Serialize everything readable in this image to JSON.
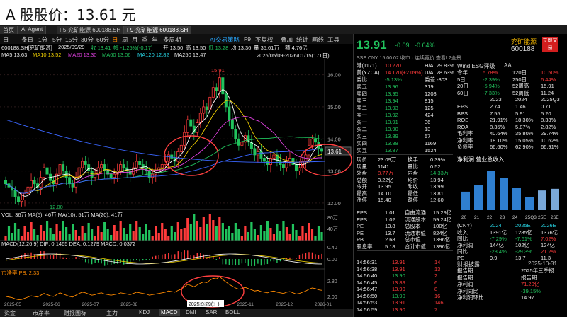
{
  "header": {
    "title": "A 股股价：13.61 元"
  },
  "tabs": [
    {
      "label": "首页",
      "active": false
    },
    {
      "label": "AI Agent",
      "active": false
    },
    {
      "label": "F5-兖矿能源 600188.SH",
      "active": false
    },
    {
      "label": "F9-兖矿能源 600188.SH",
      "active": true
    }
  ],
  "toolbar": {
    "periods": [
      "日",
      "多日",
      "1分",
      "5分",
      "15分",
      "30分",
      "60分",
      "日",
      "周",
      "月",
      "季",
      "年",
      "多周期"
    ],
    "right": [
      "AI交易策略",
      "F9",
      "不复权",
      "叠加",
      "统计",
      "画线",
      "工具"
    ]
  },
  "info_row": {
    "name": "600188.SH[兖矿能源]",
    "date": "2025/09/29",
    "close": "收 13.41",
    "change": "幅 -1.25%(-0.17)",
    "open": "开 13.50",
    "high": "高 13.50",
    "low": "低 13.28",
    "close2": "均 13.36",
    "volume": "量 35.61万",
    "turnover": "额 4.76亿"
  },
  "ma_row": {
    "ma5": "MA5 13.63",
    "ma10": "MA10 13.52",
    "ma20": "MA20 13.30",
    "ma60": "MA60 13.06",
    "ma120": "MA120 12.82",
    "ma250": "MA250 13.47",
    "range": "2025/05/09-2026/01/15(171日)"
  },
  "chart_data": {
    "type": "candlestick",
    "ylim": [
      12.0,
      16.2
    ],
    "yticks": [
      "16.00",
      "15.00",
      "14.00",
      "13.00",
      "12.00"
    ],
    "xticks": [
      "2025-05",
      "2025-06",
      "2025-07",
      "2025-08",
      "2025-09",
      "2025-10",
      "2025-11",
      "2025-12",
      "2026-01"
    ],
    "annotations": {
      "high": "15.91",
      "low": "12.00",
      "current": "13.61",
      "crosshair_date": "2025-9-29(一)"
    },
    "close": [
      12.6,
      12.5,
      12.4,
      12.2,
      12.05,
      12.1,
      12.3,
      12.5,
      12.7,
      12.6,
      12.5,
      12.8,
      13.1,
      12.9,
      12.7,
      12.6,
      12.9,
      13.2,
      13.0,
      12.8,
      12.6,
      12.5,
      12.8,
      13.1,
      13.3,
      13.2,
      13.0,
      12.8,
      12.9,
      13.1,
      13.2,
      13.0,
      12.9,
      12.8,
      12.9,
      13.0,
      13.2,
      13.1,
      13.0,
      12.9,
      13.1,
      13.3,
      13.2,
      13.1,
      13.0,
      12.8,
      12.9,
      13.0,
      13.1,
      13.2,
      13.3,
      13.5,
      13.4,
      13.3,
      13.6,
      13.8,
      14.2,
      14.6,
      14.4,
      14.2,
      14.5,
      14.8,
      15.0,
      14.9,
      15.3,
      15.6,
      15.5,
      15.91,
      15.4,
      15.0,
      14.6,
      14.3,
      14.0,
      13.8,
      13.9,
      14.1,
      13.9,
      13.7,
      13.5,
      13.6,
      13.4,
      13.3,
      13.2,
      13.4,
      13.5,
      13.3,
      13.2,
      13.1,
      13.3,
      13.4,
      13.2,
      13.0,
      13.1,
      13.3,
      13.5,
      13.8,
      14.0,
      13.9,
      13.7,
      13.61
    ],
    "ma_series": [
      {
        "name": "MA5",
        "color": "#ffffff"
      },
      {
        "name": "MA10",
        "color": "#f0d000"
      },
      {
        "name": "MA20",
        "color": "#e040e0"
      },
      {
        "name": "MA60",
        "color": "#21c35d"
      },
      {
        "name": "MA120",
        "color": "#3a66ff"
      }
    ],
    "vol_label": "VOL: 36万 MA(5): 46万 MA(10): 51万 MA(20): 41万",
    "vol_ticks": [
      "80万",
      "40万"
    ],
    "macd_label": "MACD(12,26,9) DIF: 0.1465 DEA: 0.1279 MACD: 0.0372",
    "macd_ticks": [
      "0.40",
      "0.00"
    ],
    "pb_label": "市净率 PB: 2.33",
    "pb_ticks": [
      "2.80",
      "2.00"
    ]
  },
  "bottom_tabs": [
    "资金",
    "市净率",
    "财报图标",
    "主力",
    "KDJ",
    "MACD",
    "DMI",
    "SAR",
    "BOLL"
  ],
  "quote": {
    "price": "13.91",
    "change": "-0.09",
    "pct": "-0.64%",
    "name": "兖矿能源",
    "code": "600188",
    "logo": "立即交易",
    "sub": "SSE CNY 15:00:02 收市 · 连续竞价  查看L2全景",
    "left_rows": [
      {
        "l": "港(1171)",
        "m": "10.270",
        "r": "H/A: 29.83%"
      },
      {
        "l": "美(YZCA)",
        "m": "14.170(+2.09%)",
        "r": "U/A: 28.63%"
      },
      {
        "l": "委比",
        "m": "-5.13%",
        "r": "委差 -303"
      },
      {
        "l": "卖五",
        "m": "13.96",
        "r": "319"
      },
      {
        "l": "卖四",
        "m": "13.95",
        "r": "1208"
      },
      {
        "l": "卖三",
        "m": "13.94",
        "r": "815"
      },
      {
        "l": "卖二",
        "m": "13.93",
        "r": "125"
      },
      {
        "l": "卖一",
        "m": "13.92",
        "r": "424"
      },
      {
        "l": "买一",
        "m": "13.91",
        "r": "36"
      },
      {
        "l": "买二",
        "m": "13.90",
        "r": "13"
      },
      {
        "l": "买三",
        "m": "13.89",
        "r": "57"
      },
      {
        "l": "买四",
        "m": "13.88",
        "r": "1169"
      },
      {
        "l": "买五",
        "m": "13.87",
        "r": "1524"
      }
    ],
    "stats": [
      {
        "a": "现价",
        "av": "23.09万",
        "b": "换手",
        "bv": "0.39%"
      },
      {
        "a": "现量",
        "av": "1141",
        "b": "量比",
        "bv": "0.52"
      },
      {
        "a": "外盘",
        "av": "8.77万",
        "b": "内盘",
        "bv": "14.33万"
      },
      {
        "a": "总额",
        "av": "3.22亿",
        "b": "均价",
        "bv": "13.94"
      },
      {
        "a": "今开",
        "av": "13.95",
        "b": "昨收",
        "bv": "13.99"
      },
      {
        "a": "最高",
        "av": "14.10",
        "b": "最低",
        "bv": "13.81"
      },
      {
        "a": "涨停",
        "av": "15.40",
        "b": "跌停",
        "bv": "12.60"
      }
    ],
    "fund": [
      {
        "a": "EPS",
        "av": "1.01",
        "b": "自由流通",
        "bv": "15.29亿"
      },
      {
        "a": "EPS",
        "av": "1.02",
        "b": "流通股本",
        "bv": "59.24亿"
      },
      {
        "a": "PE",
        "av": "13.8",
        "b": "总股本",
        "bv": "100亿"
      },
      {
        "a": "PE",
        "av": "13.7",
        "b": "流通市值",
        "bv": "824亿"
      },
      {
        "a": "PB",
        "av": "2.68",
        "b": "总市值",
        "bv": "1396亿"
      },
      {
        "a": "股息率",
        "av": "5.18",
        "b": "合计市值",
        "bv": "1396亿"
      }
    ],
    "ticks": [
      {
        "t": "14:56:31",
        "p": "13.91",
        "v": "14"
      },
      {
        "t": "14:56:38",
        "p": "13.91",
        "v": "13"
      },
      {
        "t": "14:56:40",
        "p": "13.90",
        "v": "2"
      },
      {
        "t": "14:56:45",
        "p": "13.89",
        "v": "6"
      },
      {
        "t": "14:56:47",
        "p": "13.90",
        "v": "8"
      },
      {
        "t": "14:56:50",
        "p": "13.90",
        "v": "16"
      },
      {
        "t": "14:56:53",
        "p": "13.91",
        "v": "146"
      },
      {
        "t": "14:56:59",
        "p": "13.90",
        "v": "7"
      }
    ]
  },
  "wind": {
    "title": "Wind ESG评级",
    "rating": "AA",
    "perf": [
      {
        "a": "今年",
        "av": "5.78%",
        "b": "120日",
        "bv": "10.50%"
      },
      {
        "a": "5日",
        "av": "-2.39%",
        "b": "250日",
        "bv": "6.44%"
      },
      {
        "a": "20日",
        "av": "-5.94%",
        "b": "52周高",
        "bv": "15.91"
      },
      {
        "a": "60日",
        "av": "-7.33%",
        "b": "52周低",
        "bv": "11.24"
      }
    ],
    "years": [
      "2023",
      "2024",
      "2025Q3"
    ],
    "fin": [
      {
        "l": "EPS",
        "v": [
          "2.74",
          "1.46",
          "0.71"
        ]
      },
      {
        "l": "BPS",
        "v": [
          "7.55",
          "5.91",
          "5.20"
        ]
      },
      {
        "l": "ROE",
        "v": [
          "21.91%",
          "18.30%",
          "8.33%"
        ]
      },
      {
        "l": "ROA",
        "v": [
          "8.35%",
          "5.87%",
          "2.82%"
        ]
      },
      {
        "l": "毛利率",
        "v": [
          "40.64%",
          "35.80%",
          "29.74%"
        ]
      },
      {
        "l": "净利率",
        "v": [
          "18.10%",
          "15.05%",
          "10.62%"
        ]
      },
      {
        "l": "负债率",
        "v": [
          "66.60%",
          "62.90%",
          "66.91%"
        ]
      }
    ],
    "bar_title": "净利润  营业总收入",
    "bar_labels": [
      "20",
      "21",
      "22",
      "23",
      "24",
      "25Q3",
      "25E",
      "26E"
    ],
    "bar_values": [
      0.45,
      0.62,
      0.95,
      0.78,
      0.55,
      0.32,
      0.48,
      0.52
    ],
    "forecast_head": [
      "(CNY)",
      "2024",
      "2025E",
      "2026E"
    ],
    "forecast": [
      {
        "l": "收入",
        "v": [
          "1391亿",
          "1285亿",
          "1376亿"
        ]
      },
      {
        "l": "同比",
        "v": [
          "-7.29%",
          "-7.61%",
          "7.02%"
        ]
      },
      {
        "l": "净利润",
        "v": [
          "144亿",
          "102亿",
          "124亿"
        ]
      },
      {
        "l": "同比",
        "v": [
          "-28.4%",
          "-29.3%",
          "21.2%"
        ]
      },
      {
        "l": "PE",
        "v": [
          "9.9",
          "13.7",
          "11.3"
        ]
      }
    ],
    "report_title": "财报披露",
    "report_date": "2025-10-31",
    "report": [
      {
        "l": "报告期",
        "v": "2025年三季报"
      },
      {
        "l": "报告期",
        "v": "报告期"
      },
      {
        "l": "净利润",
        "v": "71.20亿"
      },
      {
        "l": "净利同比",
        "v": "-39.15%"
      },
      {
        "l": "净利润环比",
        "v": "14.97"
      }
    ]
  }
}
